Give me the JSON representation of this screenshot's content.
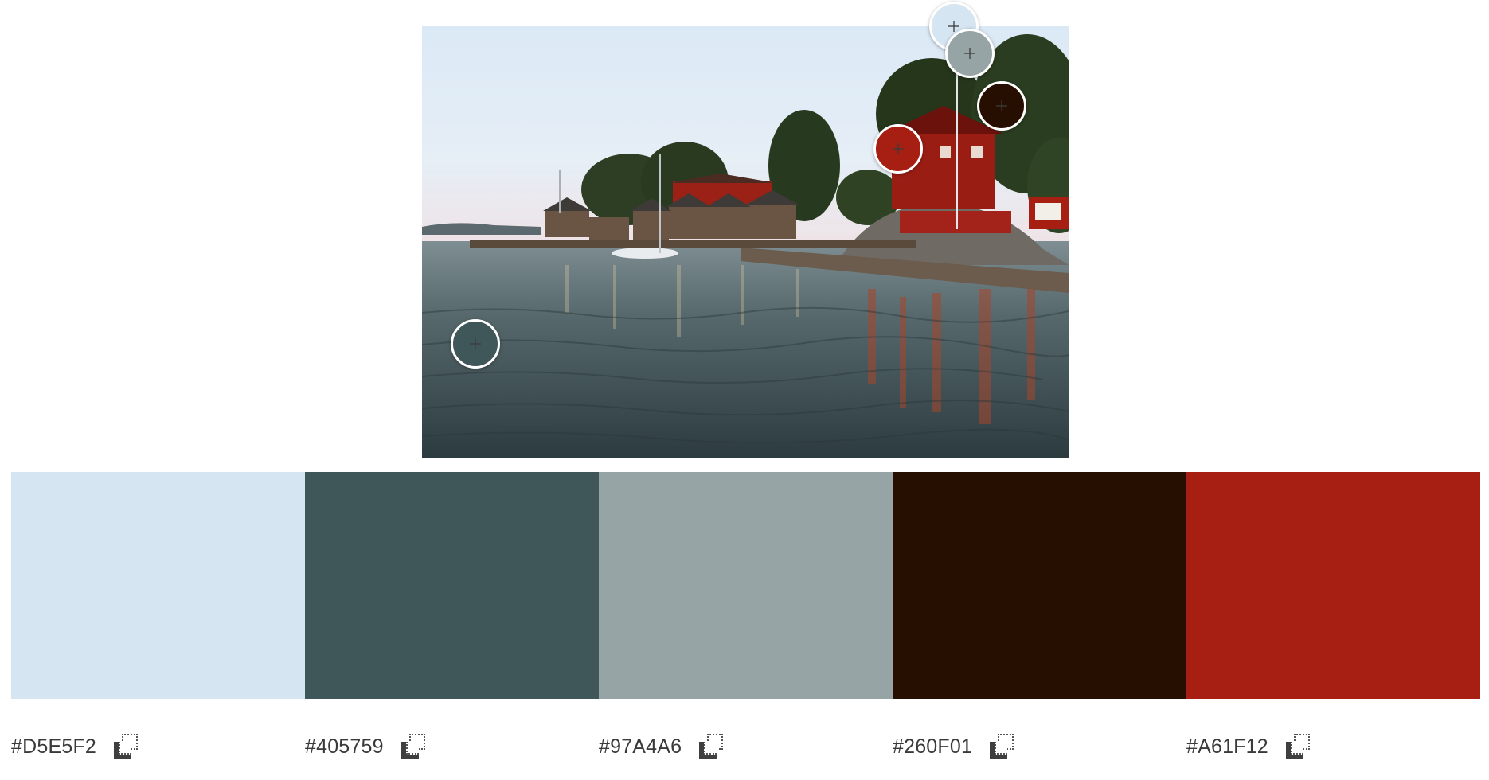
{
  "photo": {
    "icon": "harbor-landscape-photo"
  },
  "pickers": [
    {
      "name": "picker-light-blue",
      "color": "#D5E5F2"
    },
    {
      "name": "picker-dark-slate",
      "color": "#405759"
    },
    {
      "name": "picker-gray",
      "color": "#97A4A6"
    },
    {
      "name": "picker-dark-brown",
      "color": "#260F01"
    },
    {
      "name": "picker-red",
      "color": "#A61F12"
    }
  ],
  "swatches": [
    {
      "hex": "#D5E5F2",
      "color": "#D5E5F2"
    },
    {
      "hex": "#405759",
      "color": "#405759"
    },
    {
      "hex": "#97A4A6",
      "color": "#97A4A6"
    },
    {
      "hex": "#260F01",
      "color": "#260F01"
    },
    {
      "hex": "#A61F12",
      "color": "#A61F12"
    }
  ],
  "copy_icon": "copy-icon"
}
